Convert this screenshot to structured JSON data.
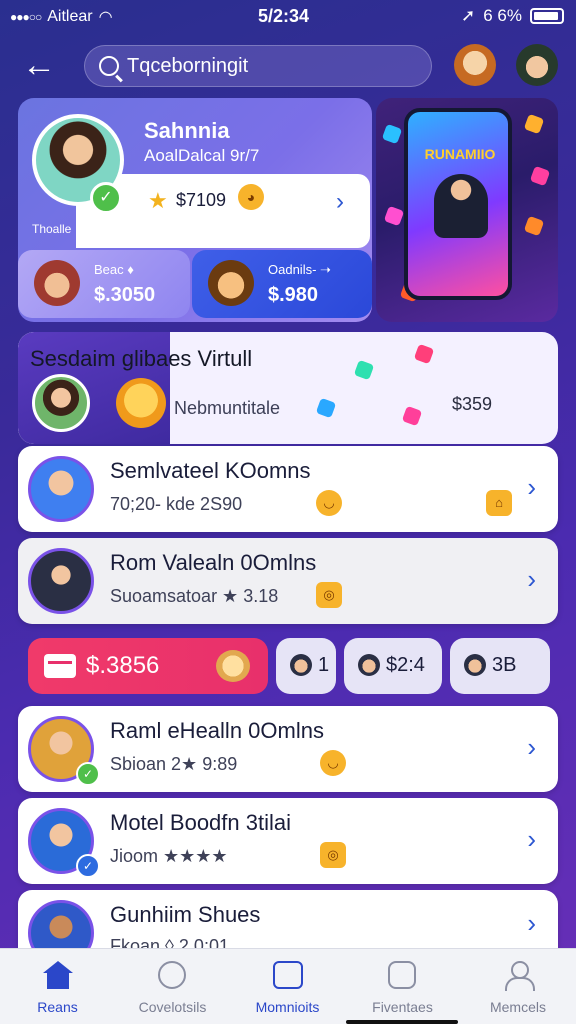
{
  "status": {
    "carrier": "Aitlear",
    "time": "5/2:34",
    "battery": "6 6%"
  },
  "search": {
    "placeholder": "Tqceborningit"
  },
  "hero": {
    "name": "Sahnnia",
    "subtitle": "AoalDalcal 9r/7",
    "stat": "$7109",
    "small_label": "Thoalle",
    "mini1": {
      "label": "Beac ♦",
      "value": "$.3050"
    },
    "mini2": {
      "label": "Oadnils- ➝",
      "value": "$.980"
    }
  },
  "promo": {
    "phone_title": "RUNAMIIO"
  },
  "feature": {
    "title_dark": "Sesdaim glibaes",
    "title_light": " Virtull",
    "subtitle": "Nebmuntitale",
    "price": "$359"
  },
  "list": [
    {
      "title": "Semlvateel KOomns",
      "sub": "70;20- kde 2S90",
      "avatar_color": "#3f7ff0"
    },
    {
      "title": "Rom Valealn 0Omlns",
      "sub": "Suoamsatoar ★ 3.18",
      "avatar_color": "#5b3fa8"
    },
    {
      "title": "Raml eHealln 0Omlns",
      "sub": "Sbioan 2★ 9:89",
      "avatar_color": "#e0a23a"
    },
    {
      "title": "Motel Boodfn 3tilai",
      "sub": "Jioom ★★★★",
      "avatar_color": "#2a6bd8"
    },
    {
      "title": "Gunhiim Shues",
      "sub": "Fkoan ◊ 2 0:01",
      "avatar_color": "#2f59c8"
    }
  ],
  "chips": {
    "price": "$.3856",
    "c1": "1",
    "c2": "$2:4",
    "c3": "3B"
  },
  "nav": [
    {
      "label": "Reans",
      "active": true
    },
    {
      "label": "Covelotsils",
      "active": false
    },
    {
      "label": "Momnioits",
      "active": false
    },
    {
      "label": "Fiventaes",
      "active": false
    },
    {
      "label": "Memcels",
      "active": false
    }
  ],
  "colors": {
    "accent": "#2b47c9",
    "pink": "#e8306b",
    "purple": "#4b2bb0"
  },
  "icons": [
    "back-arrow-icon",
    "search-icon",
    "verified-check-icon",
    "star-icon",
    "chevron-right-icon",
    "card-icon",
    "home-icon",
    "explore-icon",
    "calendar-icon",
    "favorites-icon",
    "profile-icon"
  ]
}
